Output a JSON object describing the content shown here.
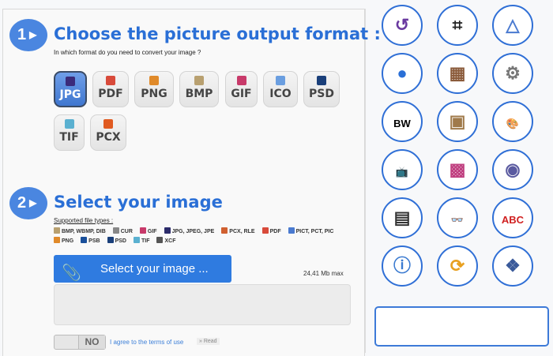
{
  "step1": {
    "number": "1",
    "title": "Choose the picture output format :",
    "subtitle": "In which format do you need to convert your image ?",
    "formats": [
      {
        "label": "JPG",
        "color": "#3b2b7a",
        "selected": true
      },
      {
        "label": "PDF",
        "color": "#d84a3a"
      },
      {
        "label": "PNG",
        "color": "#e08a2a"
      },
      {
        "label": "BMP",
        "color": "#b8a070"
      },
      {
        "label": "GIF",
        "color": "#c83a6a"
      },
      {
        "label": "ICO",
        "color": "#6a9ee0"
      },
      {
        "label": "PSD",
        "color": "#1a3f7a"
      },
      {
        "label": "TIF",
        "color": "#5ab0d0"
      },
      {
        "label": "PCX",
        "color": "#e05a20"
      }
    ]
  },
  "step2": {
    "number": "2",
    "title": "Select your image",
    "supported_label": "Supported file types :",
    "types_row1": [
      {
        "label": "BMP, WBMP, DIB",
        "color": "#b8a070"
      },
      {
        "label": "CUR",
        "color": "#888"
      },
      {
        "label": "GIF",
        "color": "#c83a6a"
      },
      {
        "label": "JPG, JPEG, JPE",
        "color": "#2b2b6a"
      },
      {
        "label": "PCX, RLE",
        "color": "#d06030"
      },
      {
        "label": "PDF",
        "color": "#d84a3a"
      },
      {
        "label": "PICT, PCT, PIC",
        "color": "#4a7ad0"
      }
    ],
    "types_row2": [
      {
        "label": "PNG",
        "color": "#e08a2a"
      },
      {
        "label": "PSB",
        "color": "#1a4f9a"
      },
      {
        "label": "PSD",
        "color": "#1a3f7a"
      },
      {
        "label": "TIF",
        "color": "#5ab0d0"
      },
      {
        "label": "XCF",
        "color": "#555"
      }
    ],
    "select_button": "Select your image ...",
    "max_size": "24,41 Mb max",
    "toggle": "NO",
    "terms": "I agree to the terms of use",
    "read": "» Read"
  },
  "tools": [
    {
      "name": "rotate-icon",
      "glyph": "↺",
      "color": "#6a3aa0"
    },
    {
      "name": "crop-icon",
      "glyph": "⌗",
      "color": "#222"
    },
    {
      "name": "mirror-icon",
      "glyph": "△",
      "color": "#4a7ad0"
    },
    {
      "name": "resize-icon",
      "glyph": "●",
      "color": "#2a6fd6"
    },
    {
      "name": "collage-icon",
      "glyph": "▦",
      "color": "#8a5a3a"
    },
    {
      "name": "compress-icon",
      "glyph": "⚙",
      "color": "#777"
    },
    {
      "name": "black-white-icon",
      "glyph": "BW",
      "color": "#000"
    },
    {
      "name": "sepia-icon",
      "glyph": "▣",
      "color": "#a07a4a"
    },
    {
      "name": "palette-icon",
      "glyph": "🎨",
      "color": "#c09060"
    },
    {
      "name": "tv-icon",
      "glyph": "📺",
      "color": "#a03020"
    },
    {
      "name": "pop-art-icon",
      "glyph": "▩",
      "color": "#c04080"
    },
    {
      "name": "sphere-icon",
      "glyph": "◉",
      "color": "#5a5aa0"
    },
    {
      "name": "sketch-icon",
      "glyph": "▤",
      "color": "#333"
    },
    {
      "name": "3d-glasses-icon",
      "glyph": "👓",
      "color": "#c03040"
    },
    {
      "name": "stamp-icon",
      "glyph": "ABC",
      "color": "#d02020"
    },
    {
      "name": "info-icon",
      "glyph": "ⓘ",
      "color": "#3a7ad0"
    },
    {
      "name": "convert-icon",
      "glyph": "⟳",
      "color": "#e8a020"
    },
    {
      "name": "formats-icon",
      "glyph": "❖",
      "color": "#3a5a9a"
    }
  ]
}
